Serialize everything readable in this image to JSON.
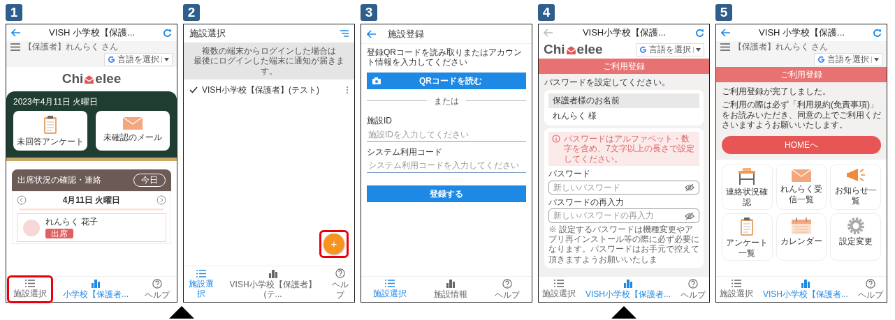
{
  "steps": [
    {
      "number": "1",
      "pointer": {
        "kind": "after"
      },
      "screen": {
        "kind": "home",
        "top_bar": {
          "title": "VISH 小学校【保護...",
          "back_disabled": false
        },
        "user_bar": {
          "user": "【保護者】れんらく さん",
          "language": "言語を選択"
        },
        "logo": {
          "left": "Chi",
          "right": "elee"
        },
        "banner": {
          "date": "2023年4月11日 火曜日",
          "cards": [
            {
              "label": "未回答アンケート"
            },
            {
              "label": "未確認のメール"
            }
          ]
        },
        "attendance": {
          "title": "出席状況の確認・連絡",
          "today_button": "今日",
          "date": "4月11日 火曜日",
          "child": {
            "name": "れんらく 花子",
            "status": "出席"
          }
        },
        "nav": [
          {
            "label": "施設選択",
            "selected": false,
            "highlighted": true
          },
          {
            "label": "小学校【保護者...",
            "selected": true,
            "highlighted": false
          },
          {
            "label": "ヘルプ",
            "selected": false,
            "highlighted": false
          }
        ]
      }
    },
    {
      "number": "2",
      "screen": {
        "kind": "facility_list",
        "title": "施設選択",
        "notice_lines": [
          "複数の端末からログインした場合は",
          "最後にログインした端末に通知が届きます。"
        ],
        "facilities": [
          {
            "name": "VISH小学校【保護者】(テスト)",
            "checked": true
          }
        ],
        "add_button": {
          "label": "+",
          "highlighted": true
        },
        "nav": [
          {
            "label": "施設選択",
            "selected": true,
            "highlighted": false
          },
          {
            "label": "VISH小学校【保護者】(テ...",
            "selected": false,
            "highlighted": false
          },
          {
            "label": "ヘルプ",
            "selected": false,
            "highlighted": false
          }
        ]
      }
    },
    {
      "number": "3",
      "screen": {
        "kind": "facility_register",
        "title": "施設登録",
        "instruction": "登録QRコードを読み取りまたはアカウント情報を入力してください",
        "qr_button": "QRコードを読む",
        "divider": "または",
        "fields": [
          {
            "label": "施設ID",
            "placeholder": "施設IDを入力してください"
          },
          {
            "label": "システム利用コード",
            "placeholder": "システム利用コードを入力してください"
          }
        ],
        "submit": "登録する",
        "nav": [
          {
            "label": "施設選択",
            "selected": true,
            "highlighted": false
          },
          {
            "label": "施設情報",
            "selected": false,
            "highlighted": false
          },
          {
            "label": "ヘルプ",
            "selected": false,
            "highlighted": false
          }
        ]
      }
    },
    {
      "number": "4",
      "pointer": {
        "kind": "center"
      },
      "screen": {
        "kind": "password_setup",
        "top_bar": {
          "title": "VISH小学校【保護...",
          "back_disabled": true
        },
        "logo": {
          "left": "Chi",
          "right": "elee"
        },
        "language": "言語を選択",
        "band": "ご利用登録",
        "instruction": "パスワードを設定してください。",
        "name_label": "保護者様のお名前",
        "name_value": "れんらく 様",
        "notice": "パスワードはアルファベット・数字を含め、7文字以上の長さで設定してください。",
        "fields": [
          {
            "label": "パスワード",
            "placeholder": "新しいパスワード"
          },
          {
            "label": "パスワードの再入力",
            "placeholder": "新しいパスワードの再入力"
          }
        ],
        "note": "※ 設定するパスワードは機種変更やアプリ再インストール等の際に必ず必要になります。パスワードはお手元で控えて頂きますようお願いいたしま",
        "nav": [
          {
            "label": "施設選択",
            "selected": false,
            "highlighted": false
          },
          {
            "label": "VISH小学校【保護者...",
            "selected": true,
            "highlighted": false
          },
          {
            "label": "ヘルプ",
            "selected": false,
            "highlighted": false
          }
        ]
      }
    },
    {
      "number": "5",
      "screen": {
        "kind": "registration_complete",
        "top_bar": {
          "title": "VISH 小学校【保護...",
          "back_disabled": false
        },
        "user_bar": {
          "user": "【保護者】れんらく さん",
          "language": "言語を選択"
        },
        "band": "ご利用登録",
        "message": "ご利用登録が完了しました。",
        "description": "ご利用の際は必ず「利用規約(免責事項)」をお読みいただき、同意の上でご利用くださいますようお願いいたします。",
        "home_button": "HOMEへ",
        "tiles": [
          {
            "label": "連絡状況確認"
          },
          {
            "label": "れんらく受信一覧"
          },
          {
            "label": "お知らせ一覧"
          },
          {
            "label": "アンケート一覧"
          },
          {
            "label": "カレンダー"
          },
          {
            "label": "設定変更"
          }
        ],
        "nav": [
          {
            "label": "施設選択",
            "selected": false,
            "highlighted": false
          },
          {
            "label": "VISH小学校【保護者...",
            "selected": true,
            "highlighted": false
          },
          {
            "label": "ヘルプ",
            "selected": false,
            "highlighted": false
          }
        ]
      }
    }
  ]
}
